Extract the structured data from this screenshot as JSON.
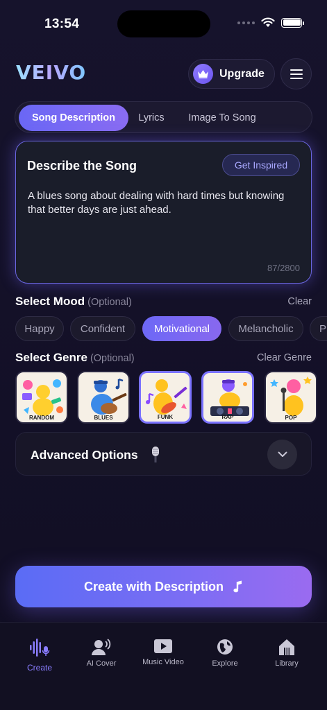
{
  "status": {
    "time": "13:54"
  },
  "header": {
    "logo": "VEIVO",
    "upgrade_label": "Upgrade"
  },
  "tabs": [
    {
      "label": "Song Description",
      "active": true
    },
    {
      "label": "Lyrics",
      "active": false
    },
    {
      "label": "Image To Song",
      "active": false
    }
  ],
  "describe": {
    "title": "Describe the Song",
    "inspired_label": "Get Inspired",
    "text": "A blues song about dealing with hard times but knowing that better days are just ahead.",
    "counter": "87/2800"
  },
  "mood": {
    "title": "Select Mood",
    "optional": "(Optional)",
    "clear_label": "Clear",
    "chips": [
      "Happy",
      "Confident",
      "Motivational",
      "Melancholic",
      "Pl"
    ],
    "selected": "Motivational"
  },
  "genre": {
    "title": "Select Genre",
    "optional": "(Optional)",
    "clear_label": "Clear Genre",
    "items": [
      "RANDOM",
      "BLUES",
      "FUNK",
      "RAP",
      "POP"
    ],
    "selected": [
      "FUNK",
      "RAP"
    ]
  },
  "advanced": {
    "label": "Advanced Options"
  },
  "create_button": {
    "label": "Create with Description"
  },
  "nav": [
    {
      "label": "Create",
      "icon": "waveform-mic-icon",
      "active": true
    },
    {
      "label": "AI Cover",
      "icon": "person-voice-icon",
      "active": false
    },
    {
      "label": "Music Video",
      "icon": "play-video-icon",
      "active": false
    },
    {
      "label": "Explore",
      "icon": "globe-icon",
      "active": false
    },
    {
      "label": "Library",
      "icon": "home-library-icon",
      "active": false
    }
  ],
  "colors": {
    "background": "#15122a",
    "accent": "#7a6df5",
    "accent_text": "#a9a8ff",
    "nav_active": "#8a7dff"
  }
}
